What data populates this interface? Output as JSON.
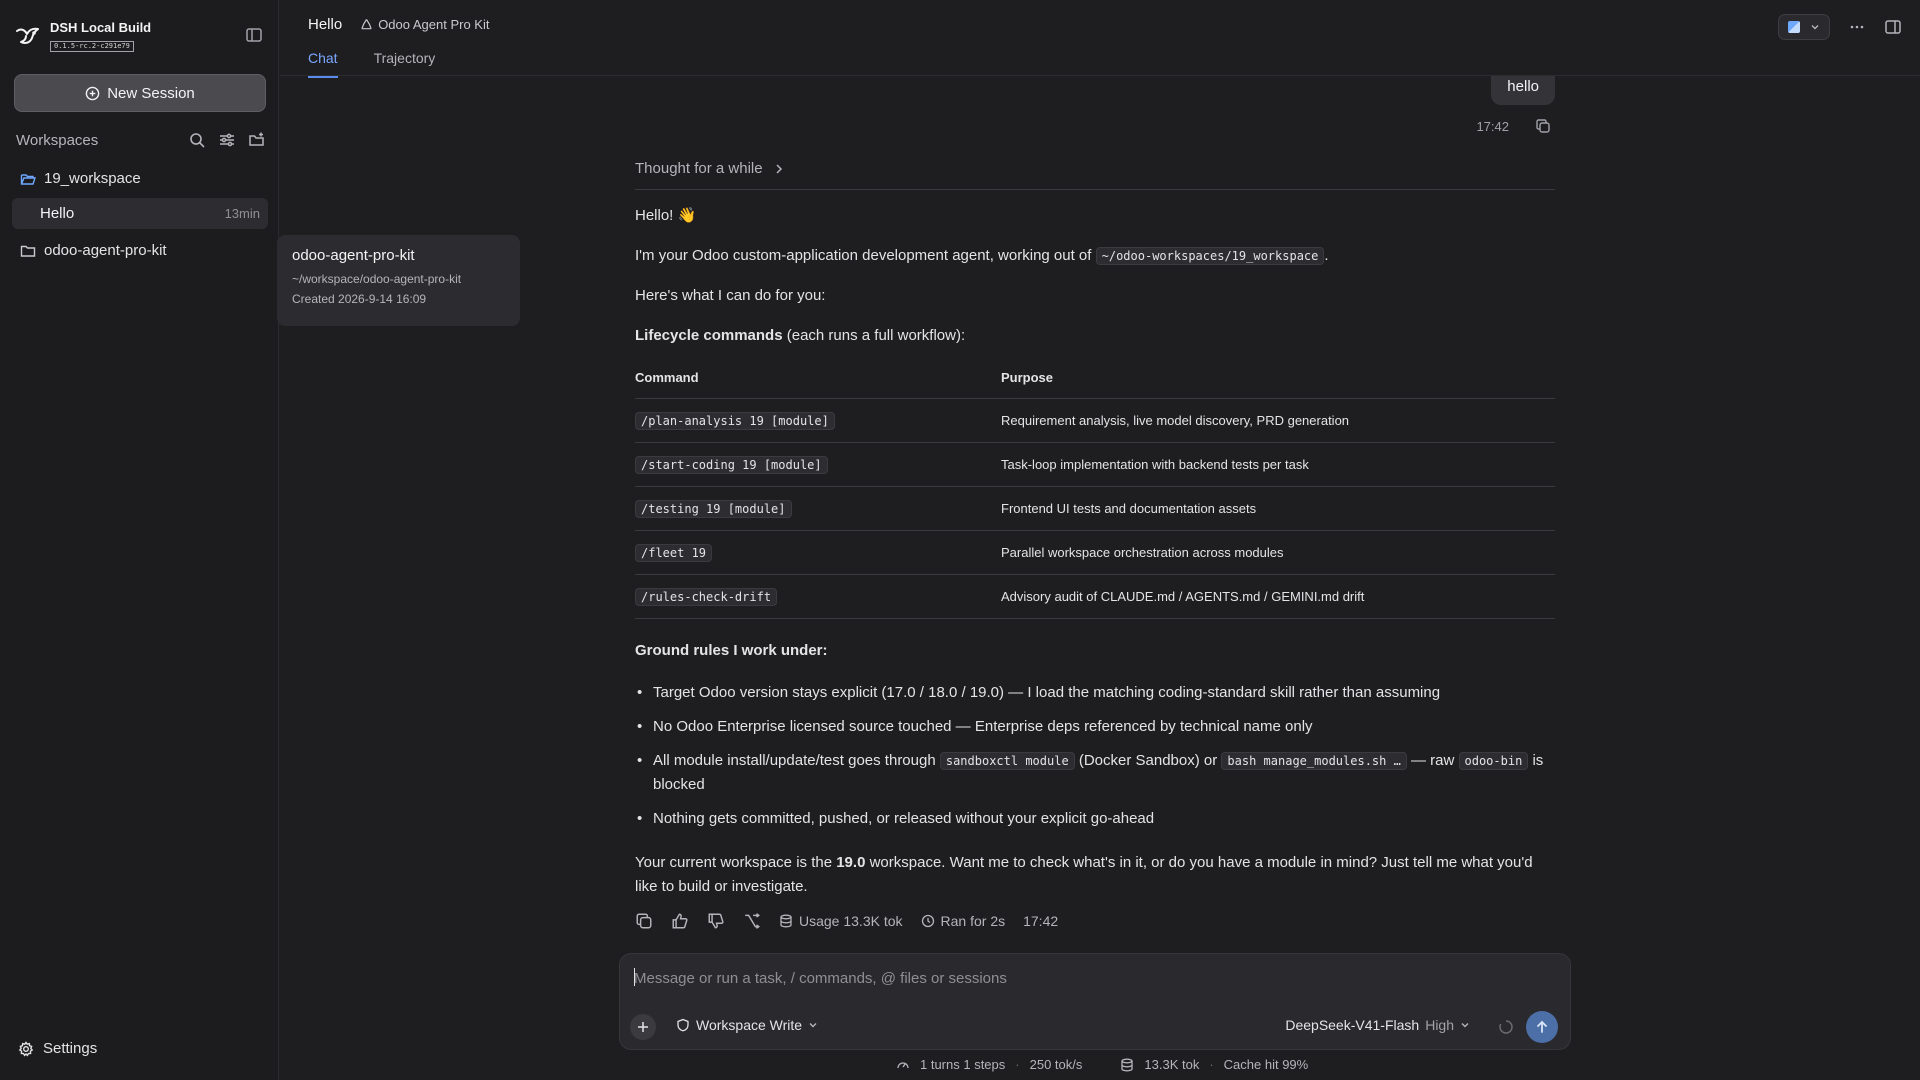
{
  "brand": {
    "name": "DSH Local Build",
    "version": "0.1.5-rc.2-c291e79",
    "logo_icon": "bird-logo-icon"
  },
  "sidebar": {
    "new_session": "New Session",
    "workspaces_title": "Workspaces",
    "workspaces": [
      {
        "name": "19_workspace",
        "sessions": [
          {
            "label": "Hello",
            "time": "13min"
          }
        ]
      },
      {
        "name": "odoo-agent-pro-kit",
        "sessions": []
      }
    ],
    "settings": "Settings"
  },
  "tooltip": {
    "title": "odoo-agent-pro-kit",
    "path": "~/workspace/odoo-agent-pro-kit",
    "created": "Created 2026-9-14 16:09"
  },
  "header": {
    "title": "Hello",
    "breadcrumb": "Odoo Agent Pro Kit",
    "tabs": [
      {
        "label": "Chat",
        "active": true
      },
      {
        "label": "Trajectory",
        "active": false
      }
    ]
  },
  "chat": {
    "user_message": "hello",
    "user_time": "17:42",
    "thought_label": "Thought for a while",
    "greeting": "Hello! 👋",
    "intro_pre": "I'm your Odoo custom-application development agent, working out of",
    "intro_path": "~/odoo-workspaces/19_workspace",
    "intro_post": ".",
    "capabilities": "Here's what I can do for you:",
    "lifecycle_bold": "Lifecycle commands",
    "lifecycle_rest": " (each runs a full workflow):",
    "table_headers": [
      "Command",
      "Purpose"
    ],
    "commands": [
      {
        "cmd": "/plan-analysis 19 [module]",
        "purpose": "Requirement analysis, live model discovery, PRD generation"
      },
      {
        "cmd": "/start-coding 19 [module]",
        "purpose": "Task-loop implementation with backend tests per task"
      },
      {
        "cmd": "/testing 19 [module]",
        "purpose": "Frontend UI tests and documentation assets"
      },
      {
        "cmd": "/fleet 19",
        "purpose": "Parallel workspace orchestration across modules"
      },
      {
        "cmd": "/rules-check-drift",
        "purpose": "Advisory audit of CLAUDE.md / AGENTS.md / GEMINI.md drift"
      }
    ],
    "rules_title": "Ground rules I work under:",
    "rules": {
      "r1": "Target Odoo version stays explicit (17.0 / 18.0 / 19.0) — I load the matching coding-standard skill rather than assuming",
      "r2": "No Odoo Enterprise licensed source touched — Enterprise deps referenced by technical name only",
      "r3_pre": "All module install/update/test goes through ",
      "r3_code1": "sandboxctl module",
      "r3_mid": " (Docker Sandbox) or ",
      "r3_code2": "bash manage_modules.sh …",
      "r3_mid2": " — raw ",
      "r3_code3": "odoo-bin",
      "r3_post": " is blocked",
      "r4": "Nothing gets committed, pushed, or released without your explicit go-ahead"
    },
    "closing_pre": "Your current workspace is the ",
    "closing_bold": "19.0",
    "closing_post": " workspace. Want me to check what's in it, or do you have a module in mind? Just tell me what you'd like to build or investigate.",
    "usage": "Usage 13.3K tok",
    "ran_for": "Ran for 2s",
    "answer_time": "17:42"
  },
  "composer": {
    "placeholder": "Message or run a task, / commands, @ files or sessions",
    "mode": "Workspace Write",
    "model": "DeepSeek-V41-Flash",
    "effort": "High"
  },
  "footer": {
    "turns": "1 turns 1 steps",
    "speed": "250 tok/s",
    "tokens": "13.3K tok",
    "cache": "Cache hit 99%"
  },
  "colors": {
    "accent": "#5b8def",
    "send": "#4d6fa8",
    "background": "#1e1e20"
  }
}
